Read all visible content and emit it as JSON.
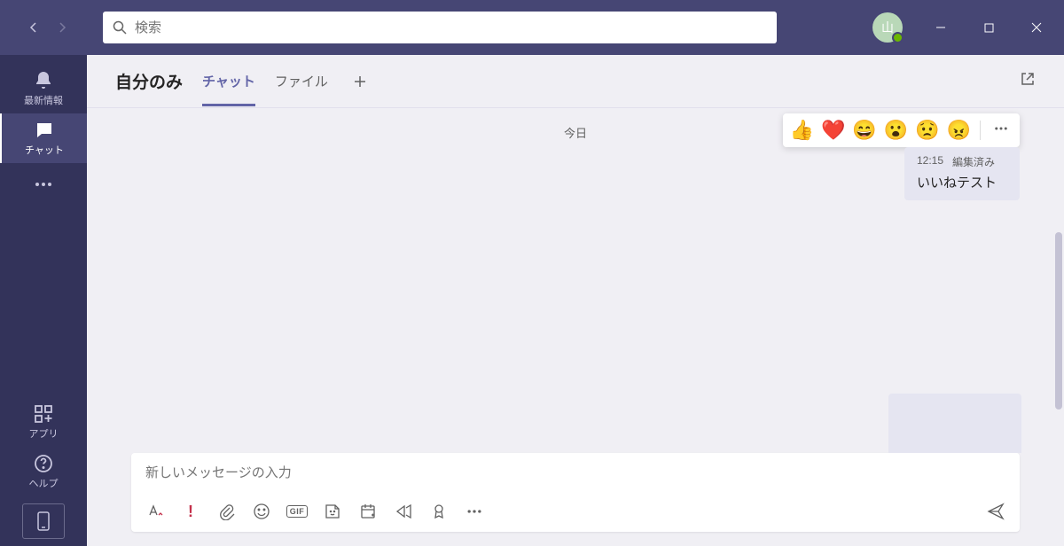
{
  "titlebar": {
    "search_placeholder": "検索",
    "avatar_initial": "山"
  },
  "rail": {
    "activity": "最新情報",
    "chat": "チャット",
    "apps": "アプリ",
    "help": "ヘルプ"
  },
  "header": {
    "title": "自分のみ",
    "tab_chat": "チャット",
    "tab_files": "ファイル"
  },
  "chat": {
    "date": "今日",
    "msg_time": "12:15",
    "msg_edited": "編集済み",
    "msg_text": "いいねテスト"
  },
  "reactions": {
    "like": "👍",
    "heart": "❤️",
    "laugh": "😄",
    "surprised": "😮",
    "sad": "😟",
    "angry": "😠"
  },
  "compose": {
    "placeholder": "新しいメッセージの入力",
    "gif_label": "GIF"
  }
}
